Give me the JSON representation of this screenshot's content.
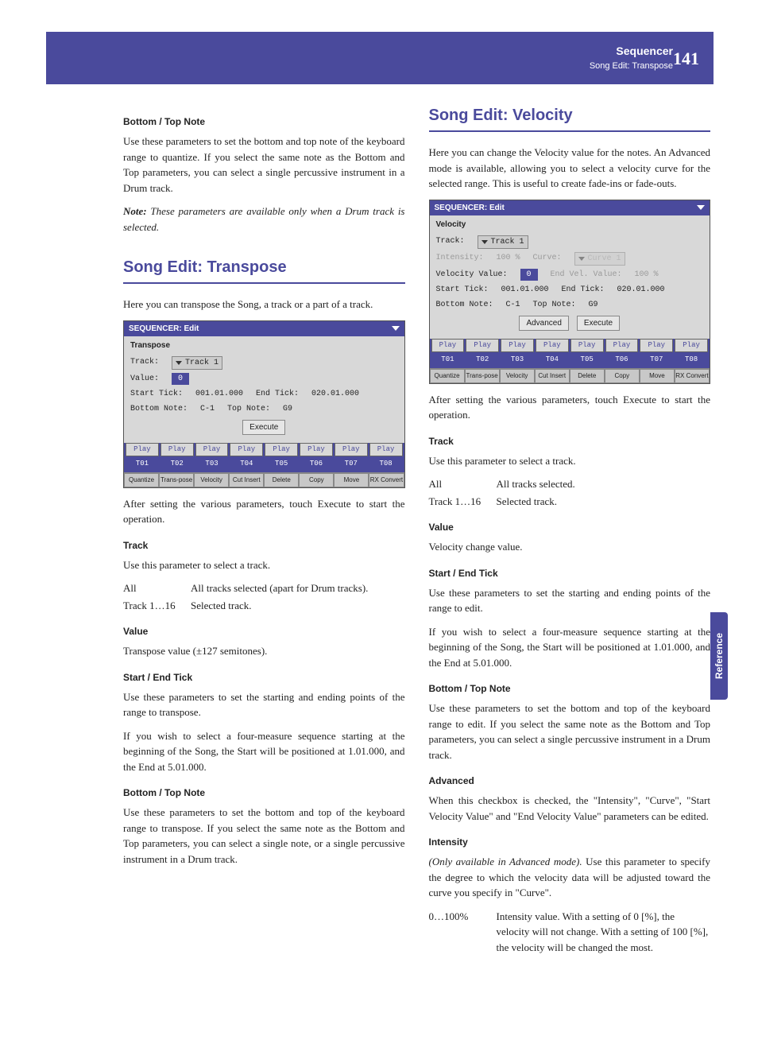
{
  "header": {
    "title": "Sequencer",
    "subtitle": "Song Edit: Transpose",
    "pageNum": "141"
  },
  "sideTab": "Reference",
  "col1": {
    "h1": "Bottom / Top Note",
    "p1": "Use these parameters to set the bottom and top note of the keyboard range to quantize. If you select the same note as the Bottom and Top parameters, you can select a single percussive instrument in a Drum track.",
    "noteLabel": "Note:",
    "noteText": " These parameters are available only when a Drum track is selected.",
    "secTitle": "Song Edit: Transpose",
    "intro": "Here you can transpose the Song, a track or a part of a track.",
    "afterExec": "After setting the various parameters, touch Execute to start the operation.",
    "h2": "Track",
    "p2": "Use this parameter to select a track.",
    "def1a": "All",
    "def1b": "All tracks selected (apart for Drum tracks).",
    "def2a": "Track 1…16",
    "def2b": "Selected track.",
    "h3": "Value",
    "p3": "Transpose value (±127 semitones).",
    "h4": "Start / End Tick",
    "p4": "Use these parameters to set the starting and ending points of the range to transpose.",
    "p4b": "If you wish to select a four-measure sequence starting at the beginning of the Song, the Start will be positioned at 1.01.000, and the End at 5.01.000.",
    "h5": "Bottom / Top Note",
    "p5": "Use these parameters to set the bottom and top of the keyboard range to transpose. If you select the same note as the Bottom and Top parameters, you can select a single note, or a single percussive instrument in a Drum track."
  },
  "shot1": {
    "title": "SEQUENCER: Edit",
    "group": "Transpose",
    "trackLbl": "Track:",
    "trackVal": "Track 1",
    "valueLbl": "Value:",
    "valueVal": "0",
    "startLbl": "Start Tick:",
    "startVal": "001.01.000",
    "endLbl": "End Tick:",
    "endVal": "020.01.000",
    "botLbl": "Bottom Note:",
    "botVal": "C-1",
    "topLbl": "Top Note:",
    "topVal": "G9",
    "exec": "Execute",
    "play": "Play",
    "trks": [
      "T01",
      "T02",
      "T03",
      "T04",
      "T05",
      "T06",
      "T07",
      "T08"
    ],
    "tabs": [
      "Quantize",
      "Trans-pose",
      "Velocity",
      "Cut Insert",
      "Delete",
      "Copy",
      "Move",
      "RX Convert"
    ]
  },
  "col2": {
    "secTitle": "Song Edit: Velocity",
    "intro": "Here you can change the Velocity value for the notes. An Advanced mode is available, allowing you to select a velocity curve for the selected range. This is useful to create fade-ins or fade-outs.",
    "afterExec": "After setting the various parameters, touch Execute to start the operation.",
    "h1": "Track",
    "p1": "Use this parameter to select a track.",
    "def1a": "All",
    "def1b": "All tracks selected.",
    "def2a": "Track 1…16",
    "def2b": "Selected track.",
    "h2": "Value",
    "p2": "Velocity change value.",
    "h3": "Start / End Tick",
    "p3": "Use these parameters to set the starting and ending points of the range to edit.",
    "p3b": "If you wish to select a four-measure sequence starting at the beginning of the Song, the Start will be positioned at 1.01.000, and the End at 5.01.000.",
    "h4": "Bottom / Top Note",
    "p4": "Use these parameters to set the bottom and top of the keyboard range to edit. If you select the same note as the Bottom and Top parameters, you can select a single percussive instrument in a Drum track.",
    "h5": "Advanced",
    "p5": "When this checkbox is checked, the \"Intensity\", \"Curve\", \"Start Velocity Value\" and \"End Velocity Value\" parameters can be edited.",
    "h6": "Intensity",
    "p6a": "(Only available in Advanced mode).",
    "p6b": " Use this parameter to specify the degree to which the velocity data will be adjusted toward the curve you specify in \"Curve\".",
    "def3a": "0…100%",
    "def3b": "Intensity value. With a setting of 0 [%], the velocity will not change. With a setting of 100 [%], the velocity will be changed the most."
  },
  "shot2": {
    "title": "SEQUENCER: Edit",
    "group": "Velocity",
    "trackLbl": "Track:",
    "trackVal": "Track 1",
    "intLbl": "Intensity:",
    "intVal": "100  %",
    "curveLbl": "Curve:",
    "curveVal": "Curve 1",
    "velValLbl": "Velocity Value:",
    "velValVal": "0",
    "endVelLbl": "End Vel. Value:",
    "endVelVal": "100  %",
    "startLbl": "Start Tick:",
    "startVal": "001.01.000",
    "endLbl": "End Tick:",
    "endVal": "020.01.000",
    "botLbl": "Bottom Note:",
    "botVal": "C-1",
    "topLbl": "Top Note:",
    "topVal": "G9",
    "advanced": "Advanced",
    "exec": "Execute",
    "play": "Play",
    "trks": [
      "T01",
      "T02",
      "T03",
      "T04",
      "T05",
      "T06",
      "T07",
      "T08"
    ],
    "tabs": [
      "Quantize",
      "Trans-pose",
      "Velocity",
      "Cut Insert",
      "Delete",
      "Copy",
      "Move",
      "RX Convert"
    ]
  }
}
